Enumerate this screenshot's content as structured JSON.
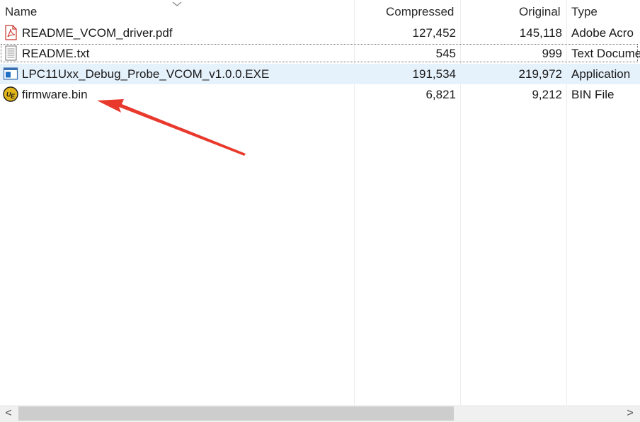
{
  "columns": {
    "name": "Name",
    "compressed": "Compressed",
    "original": "Original",
    "type": "Type"
  },
  "files": [
    {
      "name": "README_VCOM_driver.pdf",
      "compressed": "127,452",
      "original": "145,118",
      "type": "Adobe Acro",
      "icon": "pdf-icon"
    },
    {
      "name": "README.txt",
      "compressed": "545",
      "original": "999",
      "type": "Text Docume",
      "icon": "text-file-icon"
    },
    {
      "name": "LPC11Uxx_Debug_Probe_VCOM_v1.0.0.EXE",
      "compressed": "191,534",
      "original": "219,972",
      "type": "Application",
      "icon": "application-icon"
    },
    {
      "name": "firmware.bin",
      "compressed": "6,821",
      "original": "9,212",
      "type": "BIN File",
      "icon": "ultraedit-icon"
    }
  ],
  "scrollbar": {
    "left_arrow": "<",
    "right_arrow": ">"
  },
  "colors": {
    "selection": "#e5f1fb",
    "annotation_arrow": "#e8392c",
    "icon_exe_blue": "#1e6fc6",
    "icon_ue_gold": "#e2b619"
  }
}
